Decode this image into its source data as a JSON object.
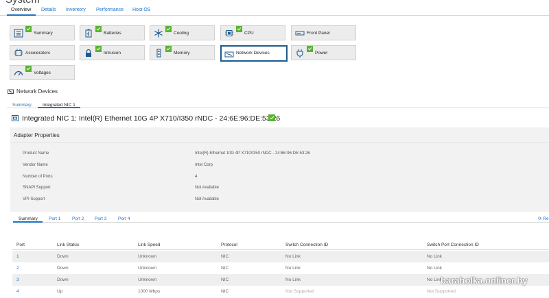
{
  "page_title": "System",
  "main_tabs": [
    "Overview",
    "Details",
    "Inventory",
    "Performance",
    "Host OS"
  ],
  "tiles": [
    {
      "label": "Summary",
      "icon": "summary-icon",
      "ok": true
    },
    {
      "label": "Batteries",
      "icon": "battery-icon",
      "ok": true
    },
    {
      "label": "Cooling",
      "icon": "fan-icon",
      "ok": true
    },
    {
      "label": "CPU",
      "icon": "cpu-icon",
      "ok": true
    },
    {
      "label": "Front Panel",
      "icon": "front-panel-icon",
      "ok": false
    },
    {
      "label": "Accelerators",
      "icon": "accelerator-icon",
      "ok": false
    },
    {
      "label": "Intrusion",
      "icon": "lock-icon",
      "ok": true
    },
    {
      "label": "Memory",
      "icon": "memory-icon",
      "ok": true
    },
    {
      "label": "Network Devices",
      "icon": "network-icon",
      "ok": false,
      "selected": true
    },
    {
      "label": "Power",
      "icon": "plug-icon",
      "ok": true
    },
    {
      "label": "Voltages",
      "icon": "gauge-icon",
      "ok": true
    }
  ],
  "section_title": "Network Devices",
  "sub_tabs": [
    "Summary",
    "Integrated NIC 1"
  ],
  "nic_title": "Integrated NIC 1: Intel(R) Ethernet 10G 4P X710/I350 rNDC - 24:6E:96:DE:53:26",
  "adapter": {
    "title": "Adapter Properties",
    "properties": [
      {
        "label": "Product Name",
        "value": "Intel(R) Ethernet 10G 4P X710/I350 rNDC - 24:6E:96:DE:53:26"
      },
      {
        "label": "Vendor Name",
        "value": "Intel Corp"
      },
      {
        "label": "Number of Ports",
        "value": "4"
      },
      {
        "label": "SNAPI Support",
        "value": "Not Available"
      },
      {
        "label": "VPI Support",
        "value": "Not Available"
      }
    ]
  },
  "port_tabs": [
    "Summary",
    "Port 1",
    "Port 2",
    "Port 3",
    "Port 4"
  ],
  "refresh_label": "Re",
  "table": {
    "columns": [
      "Port",
      "Link Status",
      "Link Speed",
      "Protocol",
      "Switch Connection ID",
      "Switch Port Connection ID"
    ],
    "rows": [
      [
        "1",
        "Down",
        "Unknown",
        "NIC",
        "No Link",
        "No Link"
      ],
      [
        "2",
        "Down",
        "Unknown",
        "NIC",
        "No Link",
        "No Link"
      ],
      [
        "3",
        "Down",
        "Unknown",
        "NIC",
        "No Link",
        "No Link"
      ],
      [
        "4",
        "Up",
        "1000 Mbps",
        "NIC",
        "Not Supported",
        "Not Supported"
      ]
    ]
  },
  "watermark": "baraholka.onliner.by",
  "colors": {
    "accent": "#1a73c8",
    "ok": "#5ab233",
    "selected_border": "#1c5a8e"
  }
}
